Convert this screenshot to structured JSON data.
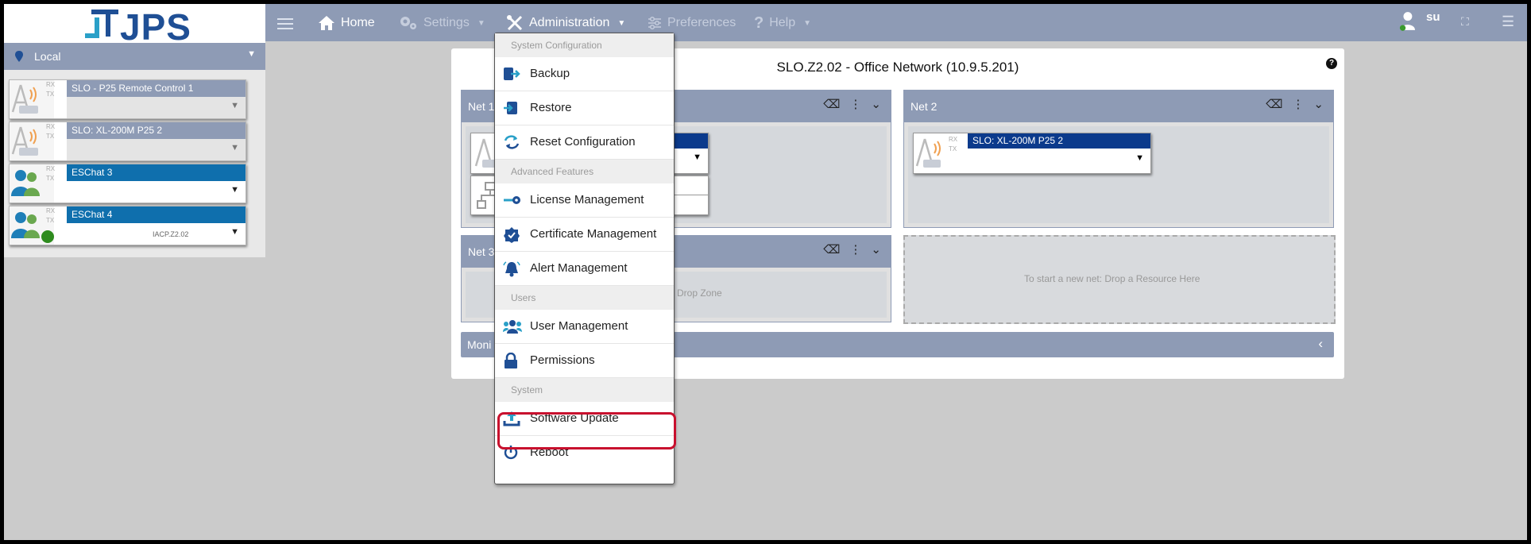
{
  "logo": {
    "text": "JPS"
  },
  "nav": {
    "home": "Home",
    "settings": "Settings",
    "administration": "Administration",
    "preferences": "Preferences",
    "help": "Help",
    "user": "su"
  },
  "sidebar": {
    "location": "Local",
    "resources": [
      {
        "name": "SLO - P25 Remote Control 1",
        "rx": "RX",
        "tx": "TX"
      },
      {
        "name": "SLO: XL-200M P25 2",
        "rx": "RX",
        "tx": "TX"
      },
      {
        "name": "ESChat 3",
        "rx": "RX",
        "tx": "TX"
      },
      {
        "name": "ESChat 4",
        "rx": "RX",
        "tx": "TX",
        "sub": "IACP.Z2.02"
      }
    ]
  },
  "main": {
    "title": "SLO.Z2.02 - Office Network (10.9.5.201)",
    "help": "?",
    "nets": [
      {
        "label": "Net 1"
      },
      {
        "label": "Net 2",
        "resource": "SLO: XL-200M P25 2"
      },
      {
        "label": "Net 3",
        "drop": "Drop Zone"
      }
    ],
    "new_net": "To start a new net: Drop a Resource Here",
    "monitor": "Moni"
  },
  "admin_menu": {
    "sections": {
      "system_configuration": "System Configuration",
      "advanced_features": "Advanced Features",
      "users": "Users",
      "system": "System"
    },
    "items": {
      "backup": "Backup",
      "restore": "Restore",
      "reset_configuration": "Reset Configuration",
      "license_management": "License Management",
      "certificate_management": "Certificate Management",
      "alert_management": "Alert Management",
      "user_management": "User Management",
      "permissions": "Permissions",
      "software_update": "Software Update",
      "reboot": "Reboot"
    }
  },
  "colors": {
    "bar": "#8e9bb5",
    "brand": "#1f4f95",
    "eschat": "#0f6fad",
    "highlight": "#c8102e",
    "menu_icon": "#1f4f95"
  }
}
